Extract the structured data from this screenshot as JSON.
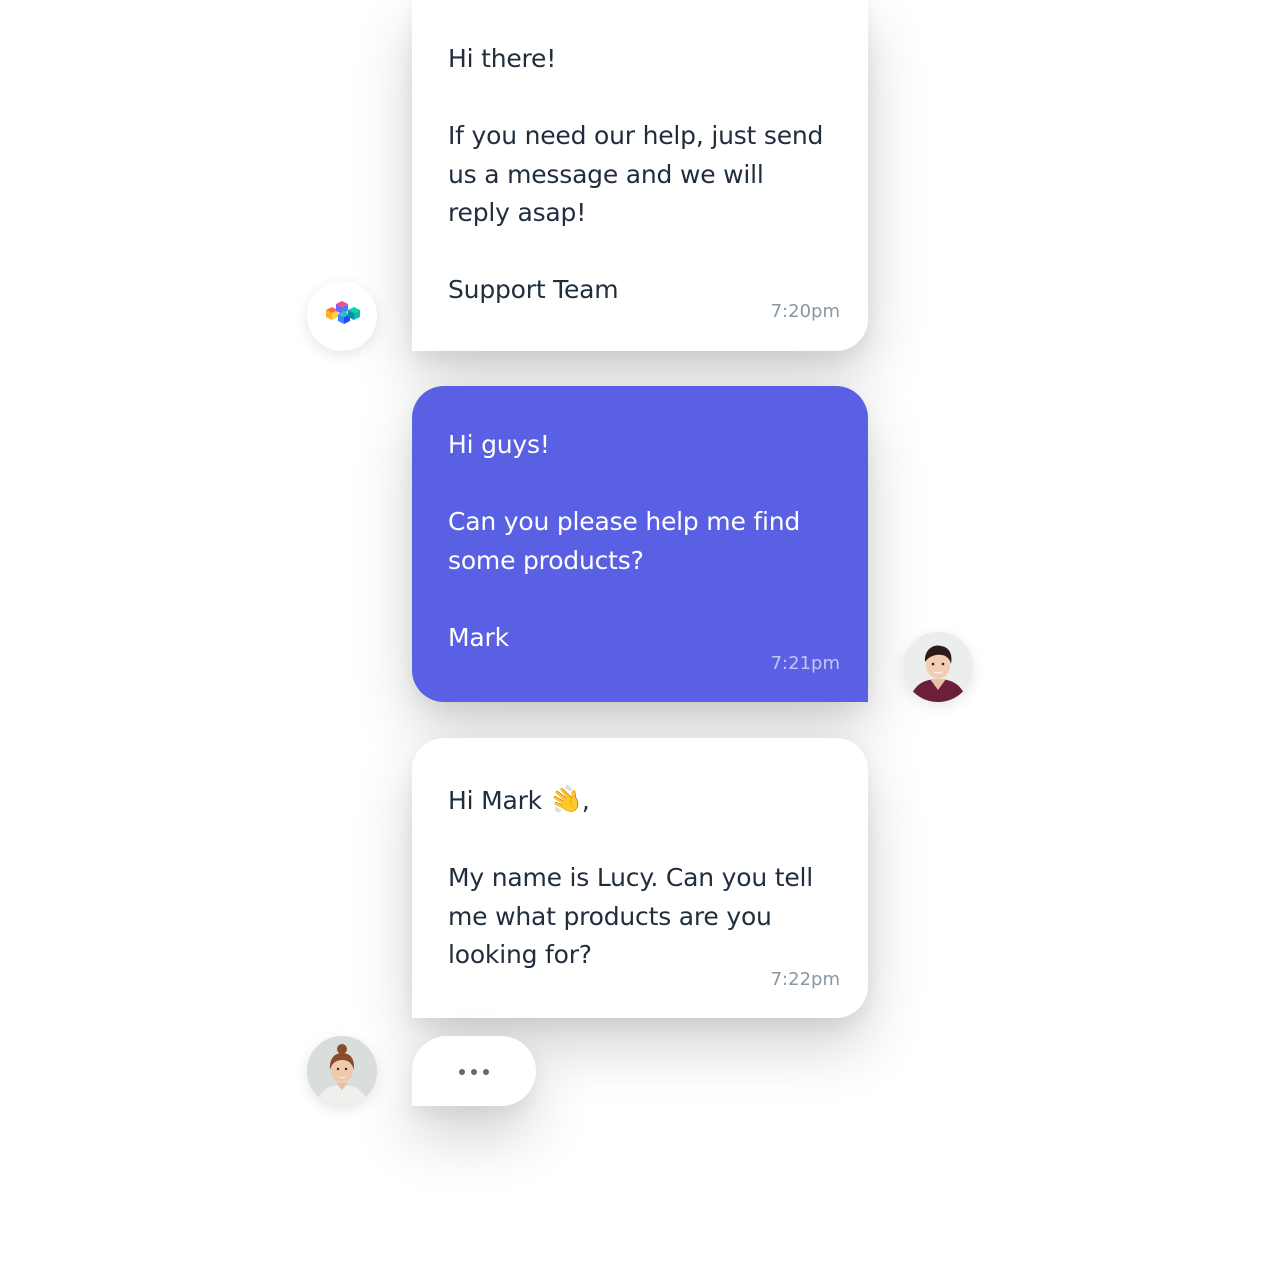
{
  "messages": [
    {
      "sender": "support",
      "lines": [
        "Hi there!",
        "",
        "If you need our help, just send",
        "us a message and we will",
        "reply asap!",
        "",
        "Support Team"
      ],
      "time": "7:20pm"
    },
    {
      "sender": "Mark",
      "lines": [
        "Hi guys!",
        "",
        "Can you please help me find",
        "some products?",
        "",
        "Mark"
      ],
      "time": "7:21pm"
    },
    {
      "sender": "Lucy",
      "greeting": "Hi Mark",
      "emoji": "👋",
      "greeting_suffix": ",",
      "lines": [
        "My name is Lucy. Can you tell",
        "me what products are you",
        "looking for?"
      ],
      "time": "7:22pm"
    }
  ],
  "typing_indicator": {
    "dots": 3
  },
  "colors": {
    "user_bubble": "#5a60e3",
    "agent_bubble": "#ffffff",
    "text_dark": "#1f2d3d",
    "timestamp": "#8a96a3"
  },
  "icons": {
    "bot_avatar": "colorful-cubes-logo-icon",
    "mark_avatar": "user-avatar-photo",
    "lucy_avatar": "agent-avatar-photo",
    "wave": "waving-hand-emoji"
  }
}
